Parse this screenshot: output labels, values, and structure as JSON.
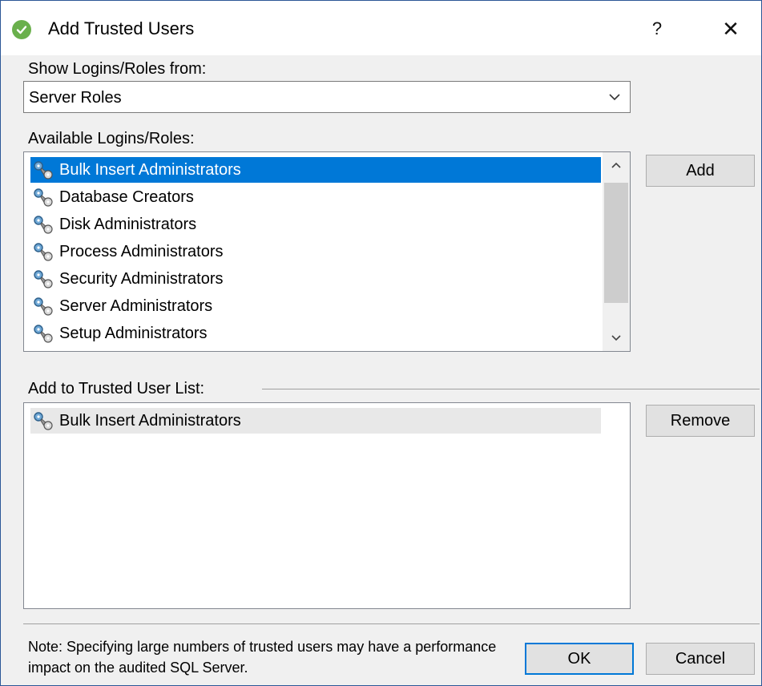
{
  "window": {
    "title": "Add Trusted Users",
    "help_label": "?",
    "close_label": "✕"
  },
  "source": {
    "label": "Show Logins/Roles from:",
    "selected": "Server Roles"
  },
  "available": {
    "label": "Available Logins/Roles:",
    "items": [
      {
        "label": "Bulk Insert Administrators",
        "selected": true
      },
      {
        "label": "Database Creators",
        "selected": false
      },
      {
        "label": "Disk Administrators",
        "selected": false
      },
      {
        "label": "Process Administrators",
        "selected": false
      },
      {
        "label": "Security Administrators",
        "selected": false
      },
      {
        "label": "Server Administrators",
        "selected": false
      },
      {
        "label": "Setup Administrators",
        "selected": false
      }
    ]
  },
  "trusted": {
    "label": "Add to Trusted User List:",
    "items": [
      {
        "label": "Bulk Insert Administrators"
      }
    ]
  },
  "buttons": {
    "add": "Add",
    "remove": "Remove",
    "ok": "OK",
    "cancel": "Cancel"
  },
  "note": "Note: Specifying large numbers of trusted users may have a performance impact on the audited SQL Server.",
  "colors": {
    "selection": "#0078d7",
    "title_icon": "#6ab04c",
    "window_border": "#2b5797"
  },
  "icons": {
    "title": "check-circle-icon",
    "item": "key-icon",
    "combo": "chevron-down-icon"
  }
}
